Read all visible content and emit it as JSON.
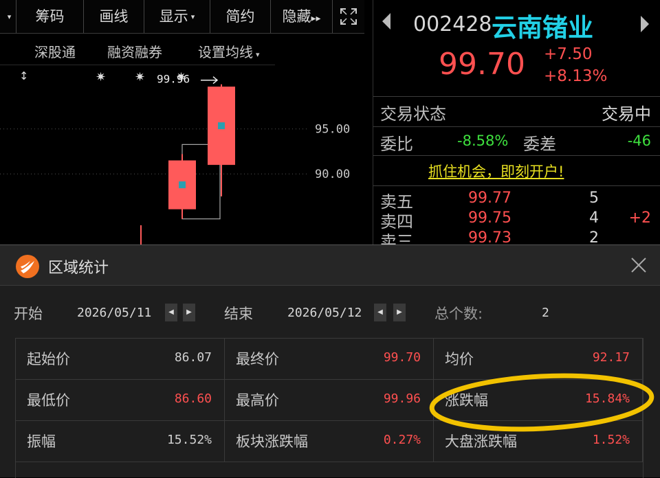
{
  "toolbar": {
    "items": [
      {
        "label": "",
        "dropdown": true
      },
      {
        "label": "筹码",
        "dropdown": false
      },
      {
        "label": "画线",
        "dropdown": false
      },
      {
        "label": "显示",
        "dropdown": true
      },
      {
        "label": "简约",
        "dropdown": false
      },
      {
        "label": "隐藏",
        "arrow": "▸▸"
      }
    ]
  },
  "subbar": {
    "items": [
      "深股通",
      "融资融券",
      "设置均线"
    ]
  },
  "chart": {
    "high_label": "99.96",
    "price_axis": [
      "95.00",
      "90.00"
    ],
    "candles": [
      {
        "open": 86.07,
        "close": 91.5,
        "high": 92.2,
        "low": 85.0
      },
      {
        "open": 91.0,
        "close": 99.7,
        "high": 99.96,
        "low": 87.5
      }
    ],
    "y_range": [
      82.0,
      102.0
    ],
    "up_color": "#ff5a5a"
  },
  "quote": {
    "code": "002428",
    "name": "云南锗业",
    "price": "99.70",
    "change": "+7.50",
    "change_pct": "+8.13%",
    "status_label": "交易状态",
    "status_value": "交易中",
    "weibi_label": "委比",
    "weibi_value": "-8.58%",
    "weicha_label": "委差",
    "weicha_value": "-46",
    "banner": "抓住机会，即刻开户!",
    "asks": [
      {
        "label": "卖五",
        "price": "99.77",
        "vol": "5",
        "delta": ""
      },
      {
        "label": "卖四",
        "price": "99.75",
        "vol": "4",
        "delta": "+2"
      },
      {
        "label": "卖三",
        "price": "99.73",
        "vol": "2",
        "delta": ""
      }
    ]
  },
  "dialog": {
    "title": "区域统计",
    "start_label": "开始",
    "start_date": "2026/05/11",
    "end_label": "结束",
    "end_date": "2026/05/12",
    "count_label": "总个数:",
    "count_value": "2",
    "rows": [
      [
        {
          "label": "起始价",
          "value": "86.07",
          "color": "#d0d0d0"
        },
        {
          "label": "最终价",
          "value": "99.70",
          "color": "#ff5050"
        },
        {
          "label": "均价",
          "value": "92.17",
          "color": "#ff5050"
        }
      ],
      [
        {
          "label": "最低价",
          "value": "86.60",
          "color": "#ff5050"
        },
        {
          "label": "最高价",
          "value": "99.96",
          "color": "#ff5050"
        },
        {
          "label": "涨跌幅",
          "value": "15.84%",
          "color": "#ff5050"
        }
      ],
      [
        {
          "label": "振幅",
          "value": "15.52%",
          "color": "#d0d0d0"
        },
        {
          "label": "板块涨跌幅",
          "value": "0.27%",
          "color": "#ff5050"
        },
        {
          "label": "大盘涨跌幅",
          "value": "1.52%",
          "color": "#ff5050"
        }
      ]
    ]
  },
  "colors": {
    "red": "#ff5050",
    "green": "#3ee03e",
    "cyan": "#22d0e6",
    "banner_yellow": "#e8e020",
    "highlight_ring": "#f2c200"
  }
}
